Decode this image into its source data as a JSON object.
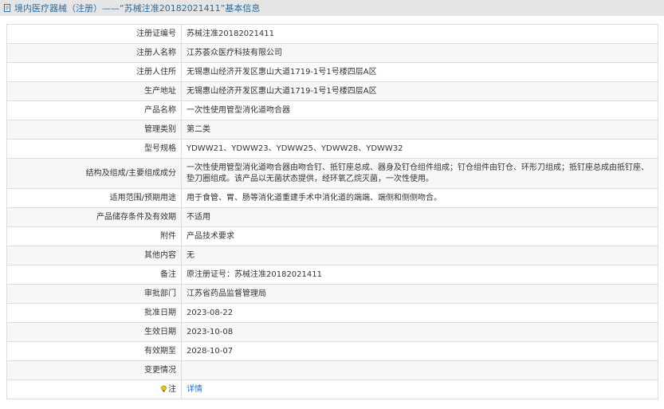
{
  "header": {
    "text": "境内医疗器械（注册）——“苏械注准20182021411”基本信息",
    "icon": "document-icon"
  },
  "rows": [
    {
      "label": "注册证编号",
      "value": "苏械注准20182021411"
    },
    {
      "label": "注册人名称",
      "value": "江苏荟众医疗科技有限公司"
    },
    {
      "label": "注册人住所",
      "value": "无锡惠山经济开发区惠山大道1719-1号1号楼四层A区"
    },
    {
      "label": "生产地址",
      "value": "无锡惠山经济开发区惠山大道1719-1号1号楼四层A区"
    },
    {
      "label": "产品名称",
      "value": "一次性使用管型消化道吻合器"
    },
    {
      "label": "管理类别",
      "value": "第二类"
    },
    {
      "label": "型号规格",
      "value": "YDWW21、YDWW23、YDWW25、YDWW28、YDWW32"
    },
    {
      "label": "结构及组成/主要组成成分",
      "value": "一次性使用管型消化道吻合器由吻合钉、抵钉座总成、器身及钉仓组件组成；钉仓组件由钉仓、环形刀组成；抵钉座总成由抵钉座、垫刀圈组成。该产品以无菌状态提供，经环氧乙烷灭菌，一次性使用。"
    },
    {
      "label": "适用范围/预期用途",
      "value": "用于食管、胃、肠等消化道重建手术中消化道的端端、端侧和侧侧吻合。"
    },
    {
      "label": "产品储存条件及有效期",
      "value": "不适用"
    },
    {
      "label": "附件",
      "value": "产品技术要求"
    },
    {
      "label": "其他内容",
      "value": "无"
    },
    {
      "label": "备注",
      "value": "原注册证号：苏械注准20182021411"
    },
    {
      "label": "审批部门",
      "value": "江苏省药品监督管理局"
    },
    {
      "label": "批准日期",
      "value": "2023-08-22"
    },
    {
      "label": "生效日期",
      "value": "2023-10-08"
    },
    {
      "label": "有效期至",
      "value": "2028-10-07"
    },
    {
      "label": "变更情况",
      "value": ""
    }
  ],
  "note_row": {
    "label": "注",
    "icon": "info-bulb-icon",
    "link_text": "详情"
  },
  "colors": {
    "header_bg": "#e5e5e5",
    "header_text": "#2f6b9a",
    "link": "#1a73c6",
    "border": "#dcdcdc"
  }
}
